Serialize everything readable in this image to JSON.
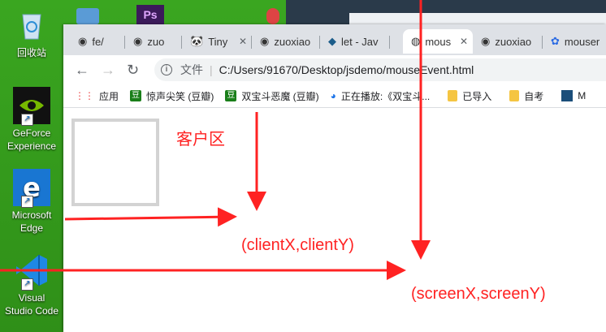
{
  "desktop": {
    "icons": [
      {
        "label": "回收站",
        "icon": "recycle-bin-icon"
      },
      {
        "label": "GeForce\nExperience",
        "icon": "geforce-icon"
      },
      {
        "label": "Microsoft\nEdge",
        "icon": "edge-icon"
      },
      {
        "label": "Visual\nStudio Code",
        "icon": "vscode-icon"
      }
    ]
  },
  "browser": {
    "tabs": [
      {
        "title": "fe/",
        "icon": "github-icon"
      },
      {
        "title": "zuo",
        "icon": "github-icon"
      },
      {
        "title": "Tiny",
        "icon": "panda-icon"
      },
      {
        "title": "zuoxiao",
        "icon": "github-icon"
      },
      {
        "title": "let - Jav",
        "icon": "bird-icon"
      },
      {
        "title": "mous",
        "icon": "globe-icon"
      },
      {
        "title": "zuoxiao",
        "icon": "github-icon"
      },
      {
        "title": "mouser",
        "icon": "paw-icon"
      }
    ],
    "address": {
      "label": "文件",
      "url": "C:/Users/91670/Desktop/jsdemo/mouseEvent.html"
    },
    "bookmarks": [
      {
        "label": "应用",
        "icon": "apps-grid-icon"
      },
      {
        "label": "惊声尖笑 (豆瓣)",
        "icon": "douban-icon"
      },
      {
        "label": "双宝斗恶魔 (豆瓣)",
        "icon": "douban-icon"
      },
      {
        "label": "正在播放:《双宝斗...",
        "icon": "player-icon"
      },
      {
        "label": "已导入",
        "icon": "folder-icon"
      },
      {
        "label": "自考",
        "icon": "folder-icon"
      },
      {
        "label": "M",
        "icon": "mysql-icon"
      }
    ]
  },
  "annotations": {
    "client_area": "客户区",
    "client_xy": "(clientX,clientY)",
    "screen_xy": "(screenX,screenY)"
  },
  "colors": {
    "annotation_red": "#ff2222",
    "desktop_green": "#3aa620"
  }
}
